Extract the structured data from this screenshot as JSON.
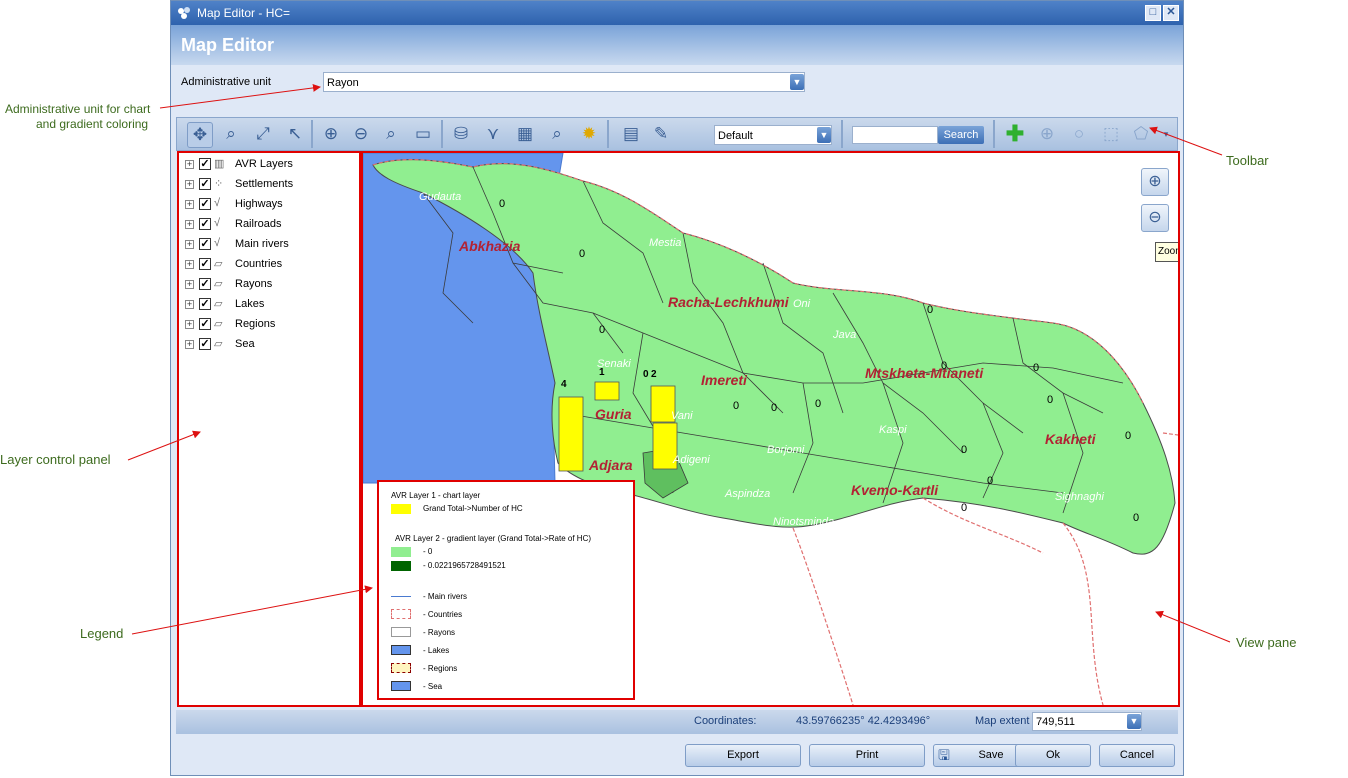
{
  "window": {
    "title": "Map Editor - HC=",
    "header": "Map Editor",
    "admin_label": "Administrative unit",
    "admin_value": "Rayon"
  },
  "toolbar": {
    "style_value": "Default",
    "search_value": "",
    "search_label": "Search"
  },
  "layers": [
    {
      "name": "AVR Layers",
      "icon": "folder-layers-icon",
      "checked": true
    },
    {
      "name": "Settlements",
      "icon": "points-icon",
      "checked": true
    },
    {
      "name": "Highways",
      "icon": "line-icon",
      "checked": true
    },
    {
      "name": "Railroads",
      "icon": "line-icon",
      "checked": true
    },
    {
      "name": "Main rivers",
      "icon": "line-icon",
      "checked": true
    },
    {
      "name": "Countries",
      "icon": "polygon-icon",
      "checked": true
    },
    {
      "name": "Rayons",
      "icon": "polygon-icon",
      "checked": true
    },
    {
      "name": "Lakes",
      "icon": "polygon-icon",
      "checked": true
    },
    {
      "name": "Regions",
      "icon": "polygon-icon",
      "checked": true
    },
    {
      "name": "Sea",
      "icon": "polygon-icon",
      "checked": true
    }
  ],
  "map": {
    "zoom_tooltip": "Zoom",
    "region_labels": [
      "Abkhazia",
      "Racha-Lechkhumi",
      "Imereti",
      "Mtskheta-Mtianeti",
      "Guria",
      "Adjara",
      "Kakheti",
      "Kvemo-Kartli"
    ],
    "rayon_labels": [
      "Gudauta",
      "Mestia",
      "Oni",
      "Java",
      "Senaki",
      "Vani",
      "Kaspi",
      "Adigeni",
      "Borjomi",
      "Aspindza",
      "Ninotsminda",
      "Sighnaghi"
    ],
    "zero_label": "0",
    "bar_labels": [
      "4",
      "1",
      "0",
      "2"
    ],
    "colors": {
      "land": "#90ee90",
      "land_dark": "#5fbf5f",
      "sea": "#6495ed",
      "bar": "#ffff00",
      "region_label": "#b22234",
      "border": "#e07070"
    }
  },
  "legend": {
    "chart_title": "AVR Layer 1 - chart layer",
    "chart_item": "Grand Total->Number of HC",
    "gradient_title": "AVR Layer 2 - gradient layer (Grand Total->Rate of HC)",
    "gradient_items": [
      "- 0",
      "- 0.0221965728491521"
    ],
    "items": [
      "- Main rivers",
      "- Countries",
      "- Rayons",
      "- Lakes",
      "- Regions",
      "- Sea"
    ]
  },
  "status": {
    "coords_label": "Coordinates:",
    "coords_value": "43.59766235°  42.4293496°",
    "extent_label": "Map extent (m.)",
    "extent_value": "749,511"
  },
  "buttons": {
    "export": "Export",
    "print": "Print",
    "save": "Save",
    "ok": "Ok",
    "cancel": "Cancel"
  },
  "annotations": {
    "admin_unit": [
      "Administrative unit for chart",
      "and gradient coloring"
    ],
    "toolbar": "Toolbar",
    "layer_panel": "Layer control panel",
    "legend": "Legend",
    "view_pane": "View pane"
  }
}
